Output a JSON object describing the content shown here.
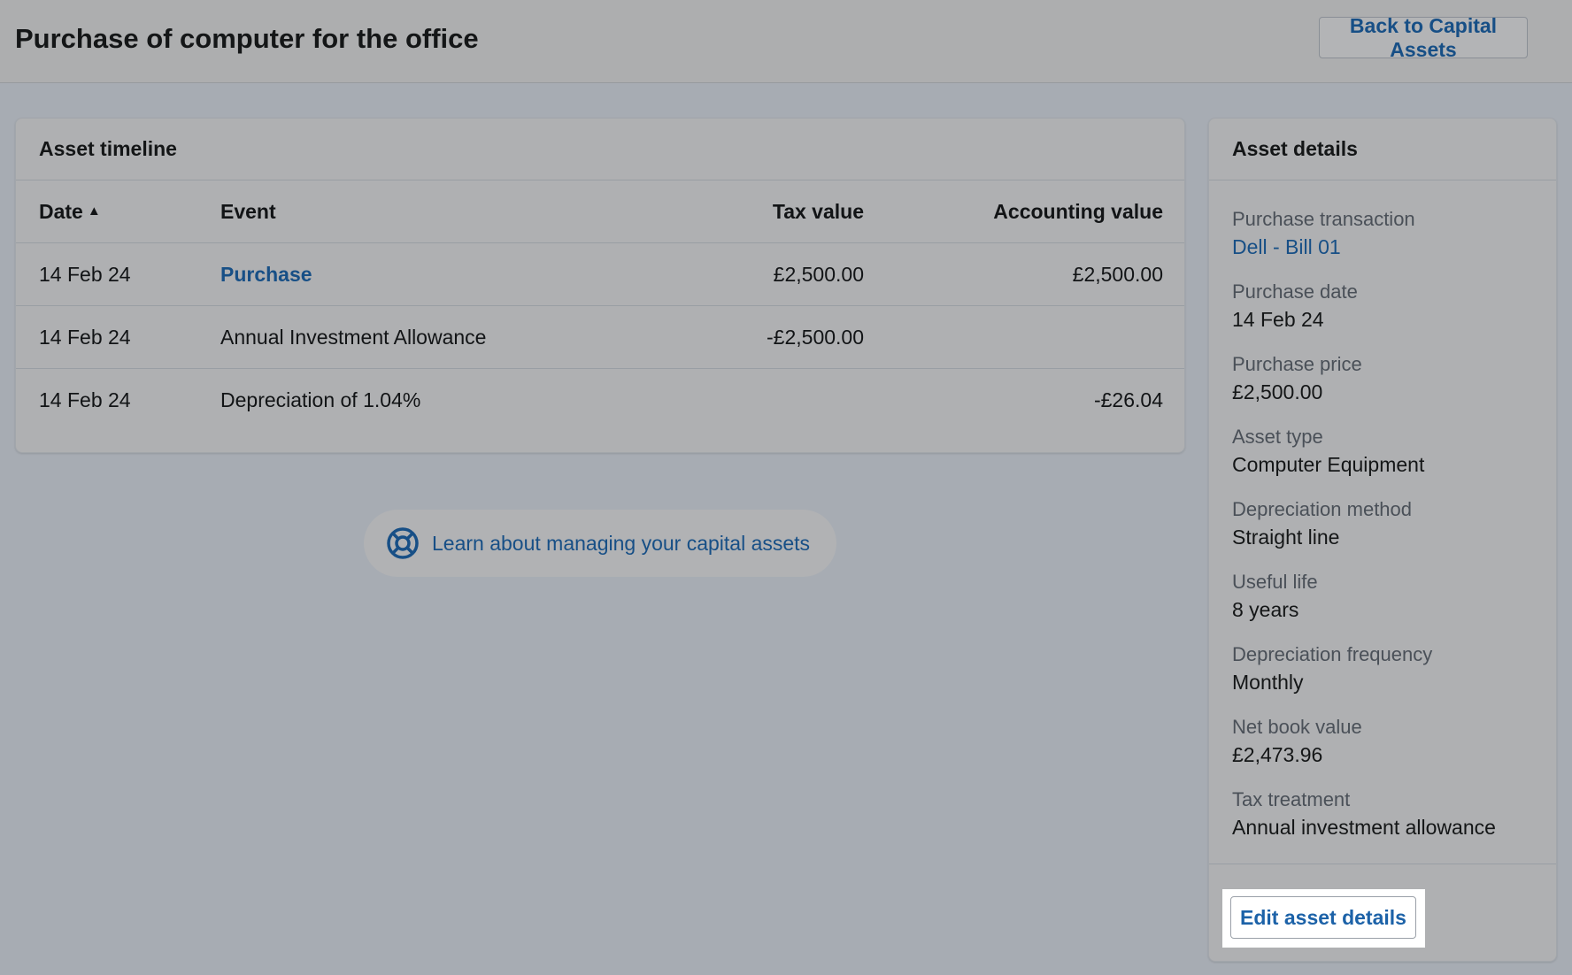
{
  "header": {
    "title": "Purchase of computer for the office",
    "back_label": "Back to Capital Assets"
  },
  "timeline": {
    "title": "Asset timeline",
    "columns": {
      "date": "Date",
      "event": "Event",
      "tax": "Tax value",
      "accounting": "Accounting value"
    },
    "sort_icon": "caret-up-icon",
    "rows": [
      {
        "date": "14 Feb 24",
        "event": "Purchase",
        "tax": "£2,500.00",
        "accounting": "£2,500.00"
      },
      {
        "date": "14 Feb 24",
        "event": "Annual Investment Allowance",
        "tax": "-£2,500.00",
        "accounting": ""
      },
      {
        "date": "14 Feb 24",
        "event": "Depreciation of 1.04%",
        "tax": "",
        "accounting": "-£26.04"
      }
    ]
  },
  "help": {
    "icon": "lifebuoy-icon",
    "label": "Learn about managing your capital assets"
  },
  "details": {
    "title": "Asset details",
    "items": [
      {
        "label": "Purchase transaction",
        "value": "Dell - Bill 01"
      },
      {
        "label": "Purchase date",
        "value": "14 Feb 24"
      },
      {
        "label": "Purchase price",
        "value": "£2,500.00"
      },
      {
        "label": "Asset type",
        "value": "Computer Equipment"
      },
      {
        "label": "Depreciation method",
        "value": "Straight line"
      },
      {
        "label": "Useful life",
        "value": "8 years"
      },
      {
        "label": "Depreciation frequency",
        "value": "Monthly"
      },
      {
        "label": "Net book value",
        "value": "£2,473.96"
      },
      {
        "label": "Tax treatment",
        "value": "Annual investment allowance"
      }
    ],
    "edit_label": "Edit asset details"
  },
  "colors": {
    "link": "#174f86",
    "overlay_background": "#a7acb3",
    "highlight": "#ffffff"
  }
}
